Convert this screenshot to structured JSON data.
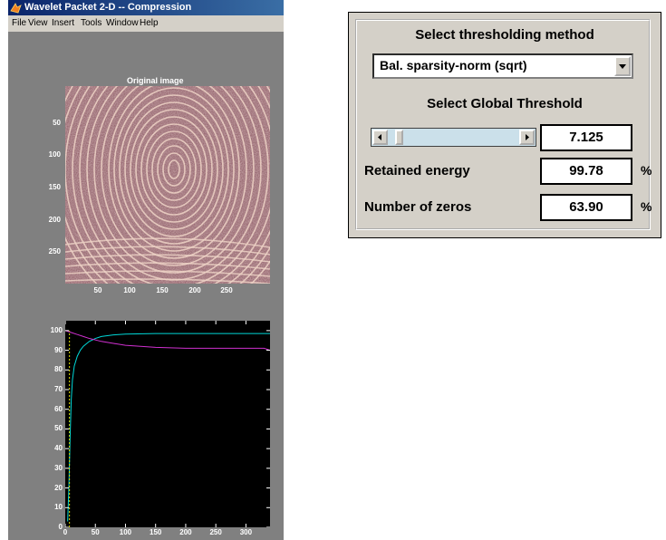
{
  "window": {
    "title": "Wavelet Packet 2-D  --  Compression",
    "menu": [
      "File",
      "View",
      "Insert",
      "Tools",
      "Window",
      "Help"
    ]
  },
  "image_axes": {
    "title": "Original image",
    "yticks": [
      "50",
      "100",
      "150",
      "200",
      "250"
    ],
    "xticks": [
      "50",
      "100",
      "150",
      "200",
      "250"
    ]
  },
  "chart_data": {
    "type": "line",
    "xlim": [
      0,
      340
    ],
    "ylim": [
      0,
      105
    ],
    "xticks": [
      "0",
      "50",
      "100",
      "150",
      "200",
      "250",
      "300"
    ],
    "yticks": [
      "0",
      "10",
      "20",
      "30",
      "40",
      "50",
      "60",
      "70",
      "80",
      "90",
      "100"
    ],
    "series": [
      {
        "color": "#00d8d8",
        "x": [
          4,
          6,
          8,
          10,
          12,
          15,
          20,
          25,
          30,
          40,
          50,
          60,
          80,
          100,
          150,
          200,
          250,
          300,
          340
        ],
        "y": [
          3,
          20,
          45,
          65,
          75,
          82,
          87,
          90,
          92,
          94.5,
          96,
          97,
          97.8,
          98.2,
          98.5,
          98.5,
          98.5,
          98.5,
          98.5
        ]
      },
      {
        "color": "#d030d0",
        "x": [
          0,
          10,
          20,
          30,
          40,
          60,
          80,
          100,
          150,
          200,
          250,
          300,
          330,
          340
        ],
        "y": [
          100,
          99,
          98,
          97,
          96,
          94.5,
          93.5,
          92.5,
          91.5,
          91,
          91,
          91,
          91,
          90
        ]
      },
      {
        "color": "#e0e000",
        "x": [
          7,
          7
        ],
        "y": [
          0,
          100
        ]
      }
    ]
  },
  "panel": {
    "method_title": "Select thresholding method",
    "method_value": "Bal. sparsity-norm (sqrt)",
    "threshold_title": "Select Global Threshold",
    "threshold_value": "7.125",
    "slider_position": 0.05,
    "energy_label": "Retained energy",
    "energy_value": "99.78",
    "zeros_label": "Number of zeros",
    "zeros_value": "63.90",
    "percent": "%"
  },
  "colors": {
    "titlebar": "#0a246a",
    "panel_bg": "#d4d0c8",
    "figure_bg": "#808080",
    "slider_trough": "#cbe0ea"
  }
}
